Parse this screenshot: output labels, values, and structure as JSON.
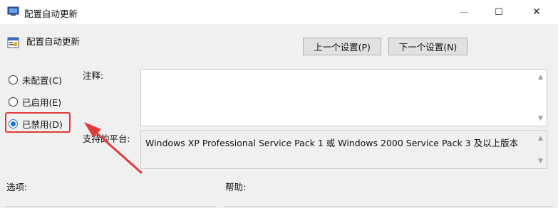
{
  "window": {
    "title": "配置自动更新",
    "controls": {
      "minimize": "—",
      "maximize": "☐",
      "close": "✕"
    }
  },
  "header": {
    "policy_name": "配置自动更新"
  },
  "nav": {
    "prev_label": "上一个设置(P)",
    "next_label": "下一个设置(N)"
  },
  "state_options": [
    {
      "label": "未配置(C)",
      "checked": false
    },
    {
      "label": "已启用(E)",
      "checked": false
    },
    {
      "label": "已禁用(D)",
      "checked": true
    }
  ],
  "comment": {
    "label": "注释:",
    "value": ""
  },
  "platform": {
    "label": "支持的平台:",
    "value": "Windows XP Professional Service Pack 1 或 Windows 2000 Service Pack 3 及以上版本"
  },
  "sections": {
    "options_label": "选项:",
    "help_label": "帮助:"
  },
  "colors": {
    "highlight": "#e03a3a",
    "radio_accent": "#1a73d9"
  }
}
